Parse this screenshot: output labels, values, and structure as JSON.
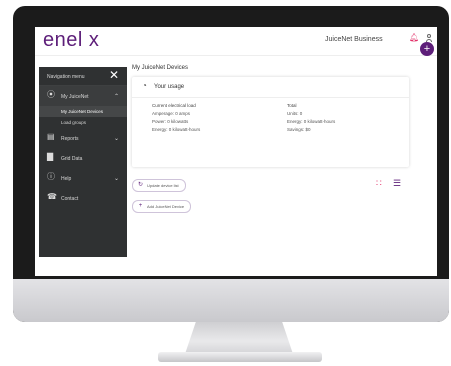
{
  "brand": {
    "logo_text": "enel x",
    "primary": "#5d1e79",
    "accent": "#e2336b"
  },
  "header": {
    "account_label": "JuiceNet Business",
    "bell_icon": "bell-icon",
    "user_icon": "user-icon",
    "fab_label": "+"
  },
  "sidebar": {
    "title": "Navigation menu",
    "close_label": "✕",
    "items": [
      {
        "label": "My JuiceNet",
        "icon": "plug-icon",
        "expanded": true,
        "sub": [
          {
            "label": "My JuiceNet Devices",
            "active": true
          },
          {
            "label": "Load groups"
          }
        ]
      },
      {
        "label": "Reports",
        "icon": "report-icon"
      },
      {
        "label": "Grid Data",
        "icon": "chart-icon"
      },
      {
        "label": "Help",
        "icon": "help-icon"
      },
      {
        "label": "Contact",
        "icon": "phone-icon"
      }
    ]
  },
  "main": {
    "title": "My JuiceNet Devices",
    "usage": {
      "title": "Your usage",
      "left_heading": "Current electrical load",
      "left_lines": [
        "Amperage: 0 amps",
        "Power: 0 kilowatts",
        "Energy: 0 kilowatt-hours"
      ],
      "right_heading": "Total",
      "right_lines": [
        "Units: 0",
        "Energy: 0 kilowatt-hours",
        "Savings: $0"
      ]
    },
    "update_label": "Update device list",
    "add_label": "Add JuiceNet Device"
  }
}
